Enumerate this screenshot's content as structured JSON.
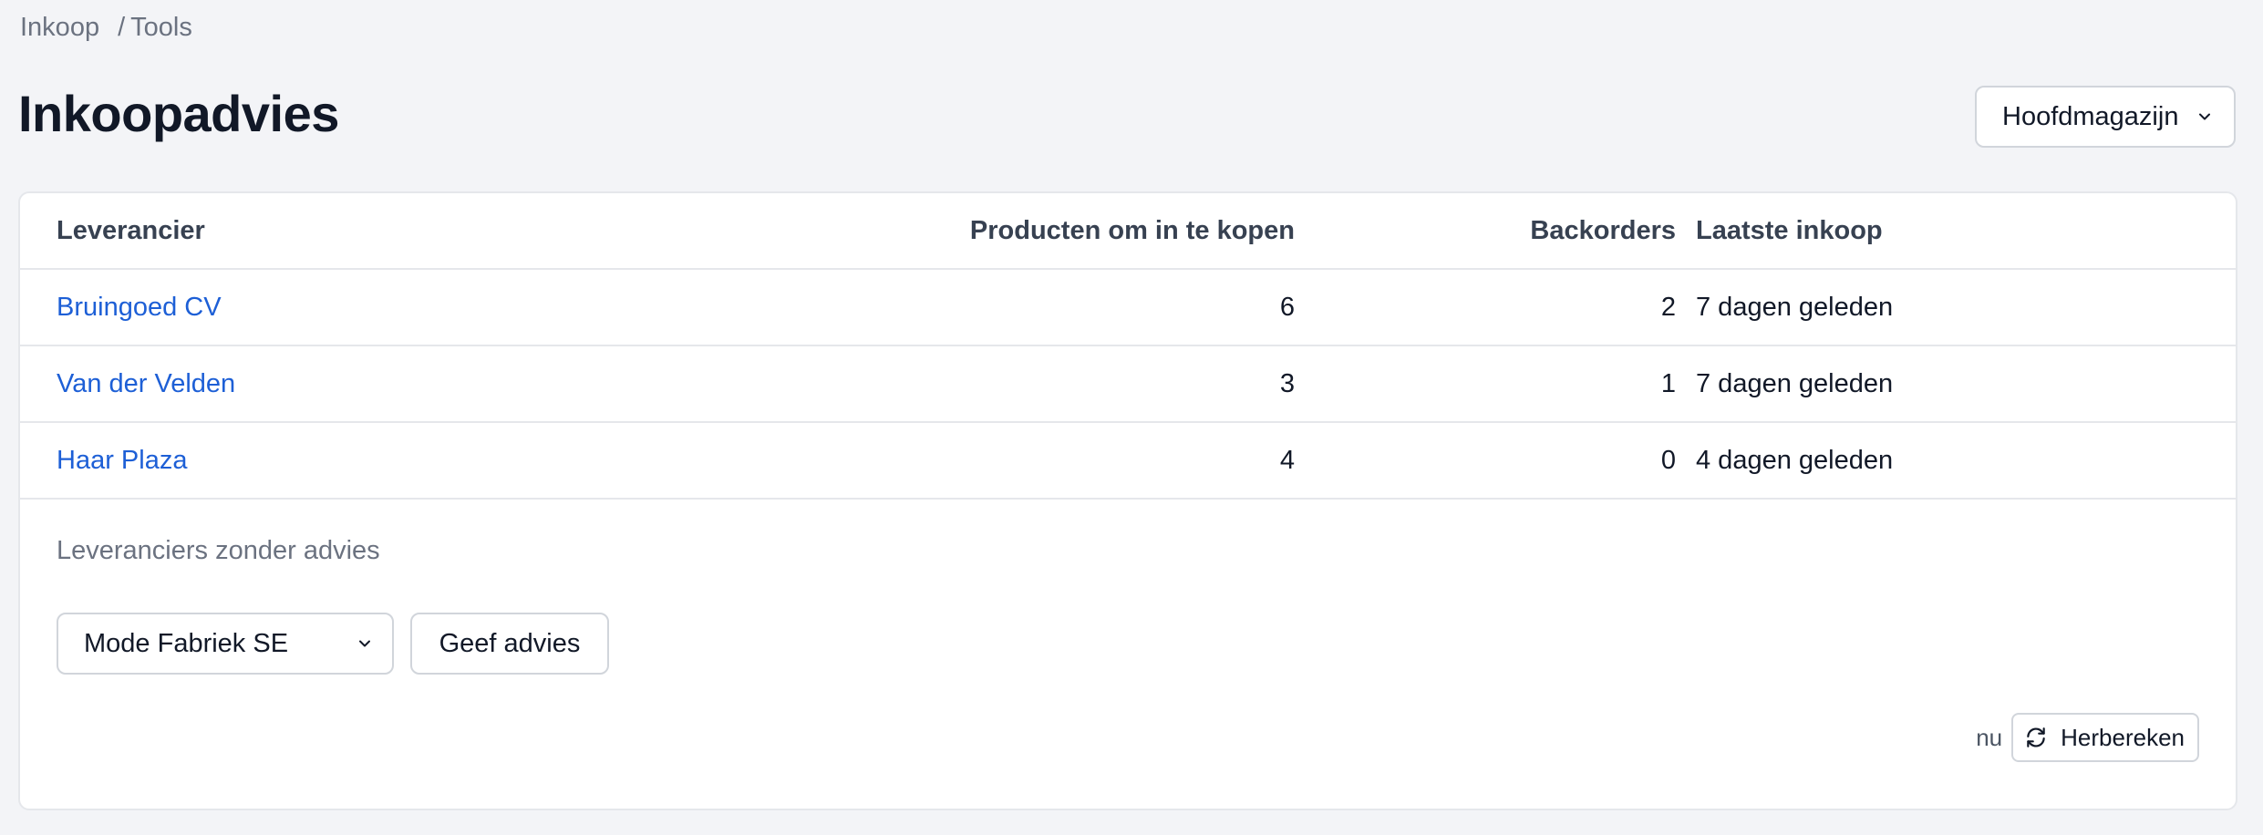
{
  "breadcrumb": {
    "items": [
      "Inkoop",
      "Tools"
    ],
    "separator": "/"
  },
  "page": {
    "title": "Inkoopadvies"
  },
  "warehouse_select": {
    "value": "Hoofdmagazijn"
  },
  "table": {
    "headers": {
      "supplier": "Leverancier",
      "products": "Producten om in te kopen",
      "backorders": "Backorders",
      "last_purchase": "Laatste inkoop"
    },
    "rows": [
      {
        "supplier": "Bruingoed CV",
        "products": "6",
        "backorders": "2",
        "last_purchase": "7 dagen geleden"
      },
      {
        "supplier": "Van der Velden",
        "products": "3",
        "backorders": "1",
        "last_purchase": "7 dagen geleden"
      },
      {
        "supplier": "Haar Plaza",
        "products": "4",
        "backorders": "0",
        "last_purchase": "4 dagen geleden"
      }
    ]
  },
  "no_advice": {
    "label": "Leveranciers zonder advies",
    "supplier_select_value": "Mode Fabriek SE",
    "button_label": "Geef advies"
  },
  "recalc": {
    "timestamp": "nu",
    "button_label": "Herbereken"
  },
  "colors": {
    "link": "#1d5fd6",
    "background": "#f3f4f7",
    "border": "#e5e7eb"
  }
}
